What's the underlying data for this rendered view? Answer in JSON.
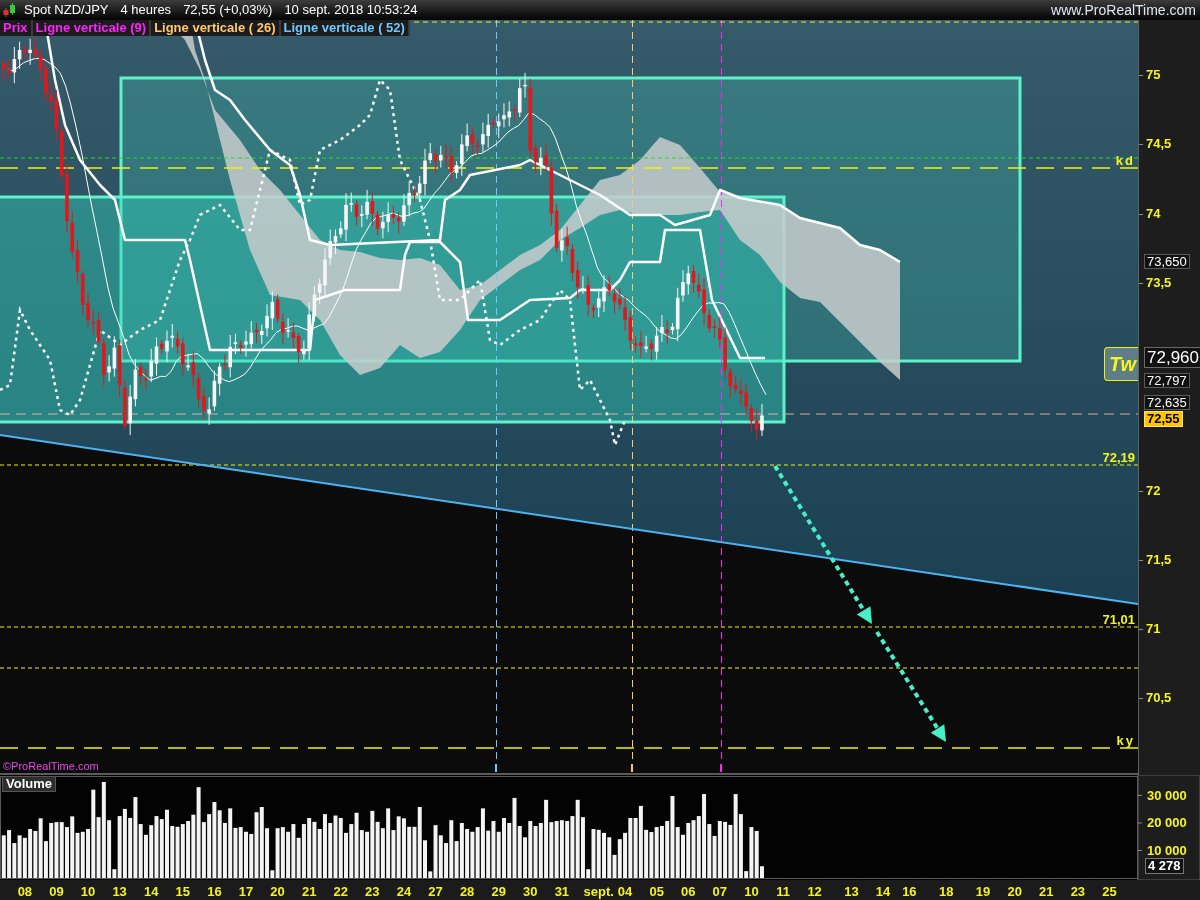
{
  "header": {
    "symbol": "Spot NZD/JPY",
    "timeframe": "4 heures",
    "price": "72,55 (+0,03%)",
    "datetime": "10 sept. 2018 10:53:24",
    "site": "www.ProRealTime.com"
  },
  "legend": [
    {
      "label": "Prix",
      "color": "#ff22ff"
    },
    {
      "label": "Ligne verticale (9)",
      "color": "#ff22ff"
    },
    {
      "label": "Ligne verticale ( 26)",
      "color": "#ffc870"
    },
    {
      "label": "Ligne verticale ( 52)",
      "color": "#70c8ff"
    }
  ],
  "price_panel": {
    "annotation": "Tw",
    "levels": [
      {
        "label": "kd",
        "kind": "long_dash"
      },
      {
        "label": "72,19",
        "kind": "dash"
      },
      {
        "label": "71,01",
        "kind": "dash"
      },
      {
        "label": "ky",
        "kind": "long_dash"
      }
    ],
    "copyright": "©ProRealTime.com"
  },
  "price_axis": {
    "ticks": [
      "75",
      "74,5",
      "74",
      "73,5",
      "72",
      "71,5",
      "71",
      "70,5"
    ],
    "tags": [
      {
        "text": "73,650",
        "kind": "tag"
      },
      {
        "text": "72,960",
        "kind": "big_tag"
      },
      {
        "text": "72,797",
        "kind": "tag"
      },
      {
        "text": "72,635",
        "kind": "tag"
      },
      {
        "text": "72,55",
        "kind": "current"
      }
    ]
  },
  "volume": {
    "last_tag": "4 278",
    "chart_data": {
      "type": "bar",
      "title": "Volume",
      "ylim": [
        0,
        36700
      ],
      "yticks": [
        {
          "value": 10000,
          "label": "10 000"
        },
        {
          "value": 20000,
          "label": "20 000"
        },
        {
          "value": 30000,
          "label": "30 000"
        }
      ],
      "categories": [
        null,
        null,
        null,
        null,
        "08",
        null,
        null,
        null,
        null,
        null,
        "09",
        null,
        null,
        null,
        null,
        null,
        "10",
        null,
        null,
        null,
        null,
        null,
        "13",
        null,
        null,
        null,
        null,
        null,
        "14",
        null,
        null,
        null,
        null,
        null,
        "15",
        null,
        null,
        null,
        null,
        null,
        "16",
        null,
        null,
        null,
        null,
        null,
        "17",
        null,
        null,
        null,
        null,
        null,
        "20",
        null,
        null,
        null,
        null,
        null,
        "21",
        null,
        null,
        null,
        null,
        null,
        "22",
        null,
        null,
        null,
        null,
        null,
        "23",
        null,
        null,
        null,
        null,
        null,
        "24",
        null,
        null,
        null,
        null,
        null,
        "27",
        null,
        null,
        null,
        null,
        null,
        "28",
        null,
        null,
        null,
        null,
        null,
        "29",
        null,
        null,
        null,
        null,
        null,
        "30",
        null,
        null,
        null,
        null,
        null,
        "31",
        null,
        null,
        null,
        null,
        null,
        null,
        "sept.",
        null,
        null,
        null,
        null,
        "04",
        null,
        null,
        null,
        null,
        null,
        "05",
        null,
        null,
        null,
        null,
        null,
        "06",
        null,
        null,
        null,
        null,
        null,
        "07",
        null,
        null,
        null,
        null,
        null,
        "10",
        null,
        null,
        null,
        null,
        null,
        "11",
        null,
        null,
        null,
        null,
        null,
        "12",
        null,
        null,
        null,
        null,
        null,
        null,
        "13",
        null,
        null,
        null,
        null,
        null,
        "14",
        null,
        null,
        null,
        null,
        "16",
        null,
        null,
        null,
        null,
        null,
        null,
        "18",
        null,
        null,
        null,
        null,
        null,
        null,
        "19",
        null,
        null,
        null,
        null,
        null,
        "20",
        null,
        null,
        null,
        null,
        null,
        "21",
        null,
        null,
        null,
        null,
        null,
        "23",
        null,
        null,
        null,
        null,
        null,
        "25"
      ],
      "values": [
        15500,
        17400,
        12700,
        15500,
        14600,
        17800,
        17100,
        21700,
        13400,
        20000,
        20300,
        20300,
        18500,
        22400,
        16400,
        16800,
        17800,
        32100,
        22100,
        34900,
        21000,
        3200,
        22500,
        25100,
        21800,
        29400,
        19600,
        15700,
        19200,
        22500,
        21400,
        24800,
        18900,
        18600,
        19600,
        20700,
        23000,
        33000,
        20300,
        23200,
        27600,
        24600,
        20000,
        25300,
        18200,
        18500,
        16800,
        16000,
        23900,
        25800,
        18100,
        2800,
        18100,
        18500,
        16800,
        19600,
        14600,
        19600,
        21800,
        20400,
        17800,
        23200,
        20000,
        22700,
        21800,
        16400,
        19600,
        23700,
        17400,
        16800,
        24400,
        20400,
        18100,
        25300,
        17400,
        22400,
        21700,
        18600,
        18600,
        25800,
        13700,
        2400,
        19200,
        15500,
        12700,
        21000,
        13400,
        20000,
        17800,
        16800,
        18500,
        25300,
        17200,
        20700,
        16800,
        21800,
        20000,
        29100,
        18900,
        14800,
        20700,
        18900,
        20000,
        28400,
        20300,
        20700,
        21000,
        20700,
        22500,
        28400,
        22100,
        3200,
        17800,
        17500,
        16400,
        14800,
        8400,
        14100,
        16400,
        21800,
        21800,
        26200,
        17500,
        16700,
        18500,
        18900,
        20700,
        29800,
        18500,
        15700,
        20000,
        21000,
        22500,
        30500,
        19600,
        15300,
        20700,
        20400,
        19300,
        30500,
        23200,
        2500,
        18500,
        17100,
        4278,
        null,
        null,
        null,
        null,
        null,
        null,
        null,
        null,
        null,
        null,
        null,
        null,
        null,
        null,
        null,
        null,
        null,
        null,
        null,
        null,
        null,
        null,
        null,
        null,
        null,
        null,
        null,
        null,
        null,
        null,
        null,
        null,
        null,
        null,
        null,
        null,
        null,
        null,
        null,
        null,
        null,
        null,
        null,
        null,
        null,
        null,
        null,
        null,
        null,
        null,
        null,
        null,
        null,
        null,
        null,
        null,
        null,
        null,
        null,
        null,
        null,
        null,
        null,
        null,
        null,
        null
      ]
    }
  }
}
